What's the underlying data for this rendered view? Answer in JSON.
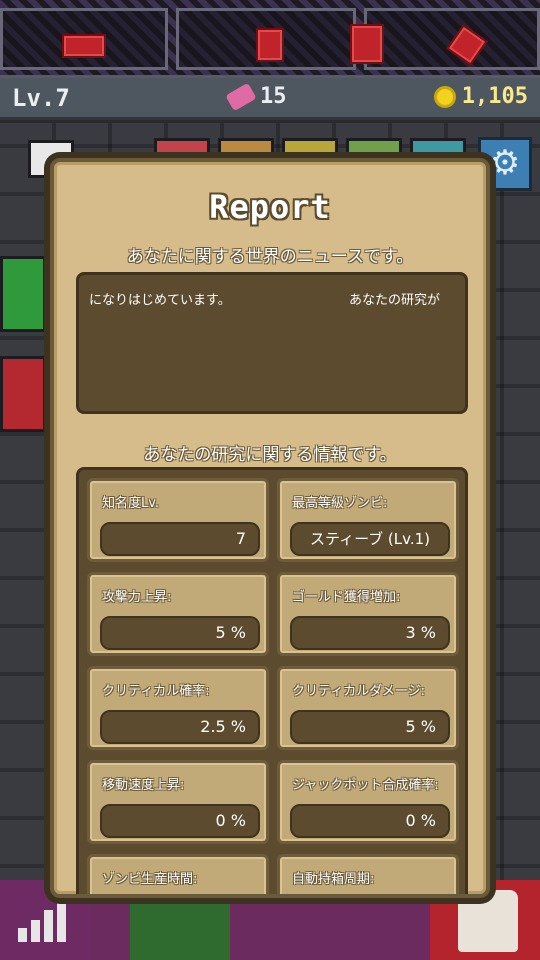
{
  "status_bar": {
    "level": "Lv.7",
    "candy": "15",
    "gold": "1,105"
  },
  "icons": {
    "settings": "gear-icon",
    "stats": "bar-chart-icon",
    "zombie": "skull-icon"
  },
  "report": {
    "title": "Report",
    "news_heading": "あなたに関する世界のニュースです。",
    "news_ticker": [
      "になりはじめています。",
      "あなたの研究が"
    ],
    "stats_heading": "あなたの研究に関する情報です。",
    "stats": [
      {
        "label": "知名度Lv.",
        "value": "7"
      },
      {
        "label": "最高等級ゾンビ:",
        "value": "スティーブ (Lv.1)"
      },
      {
        "label": "攻撃力上昇:",
        "value": "5 %"
      },
      {
        "label": "ゴールド獲得増加:",
        "value": "3 %"
      },
      {
        "label": "クリティカル確率:",
        "value": "2.5 %"
      },
      {
        "label": "クリティカルダメージ:",
        "value": "5 %"
      },
      {
        "label": "移動速度上昇:",
        "value": "0 %"
      },
      {
        "label": "ジャックポット合成確率:",
        "value": "0 %"
      },
      {
        "label": "ゾンビ生産時間:",
        "value": ""
      },
      {
        "label": "自動持箱周期:",
        "value": ""
      }
    ]
  },
  "colors": {
    "modal_bg": "#d5bc8a",
    "panel_bg": "#5c4b2e",
    "card_bg": "#c2aa78",
    "gold_text": "#f7e98c"
  }
}
